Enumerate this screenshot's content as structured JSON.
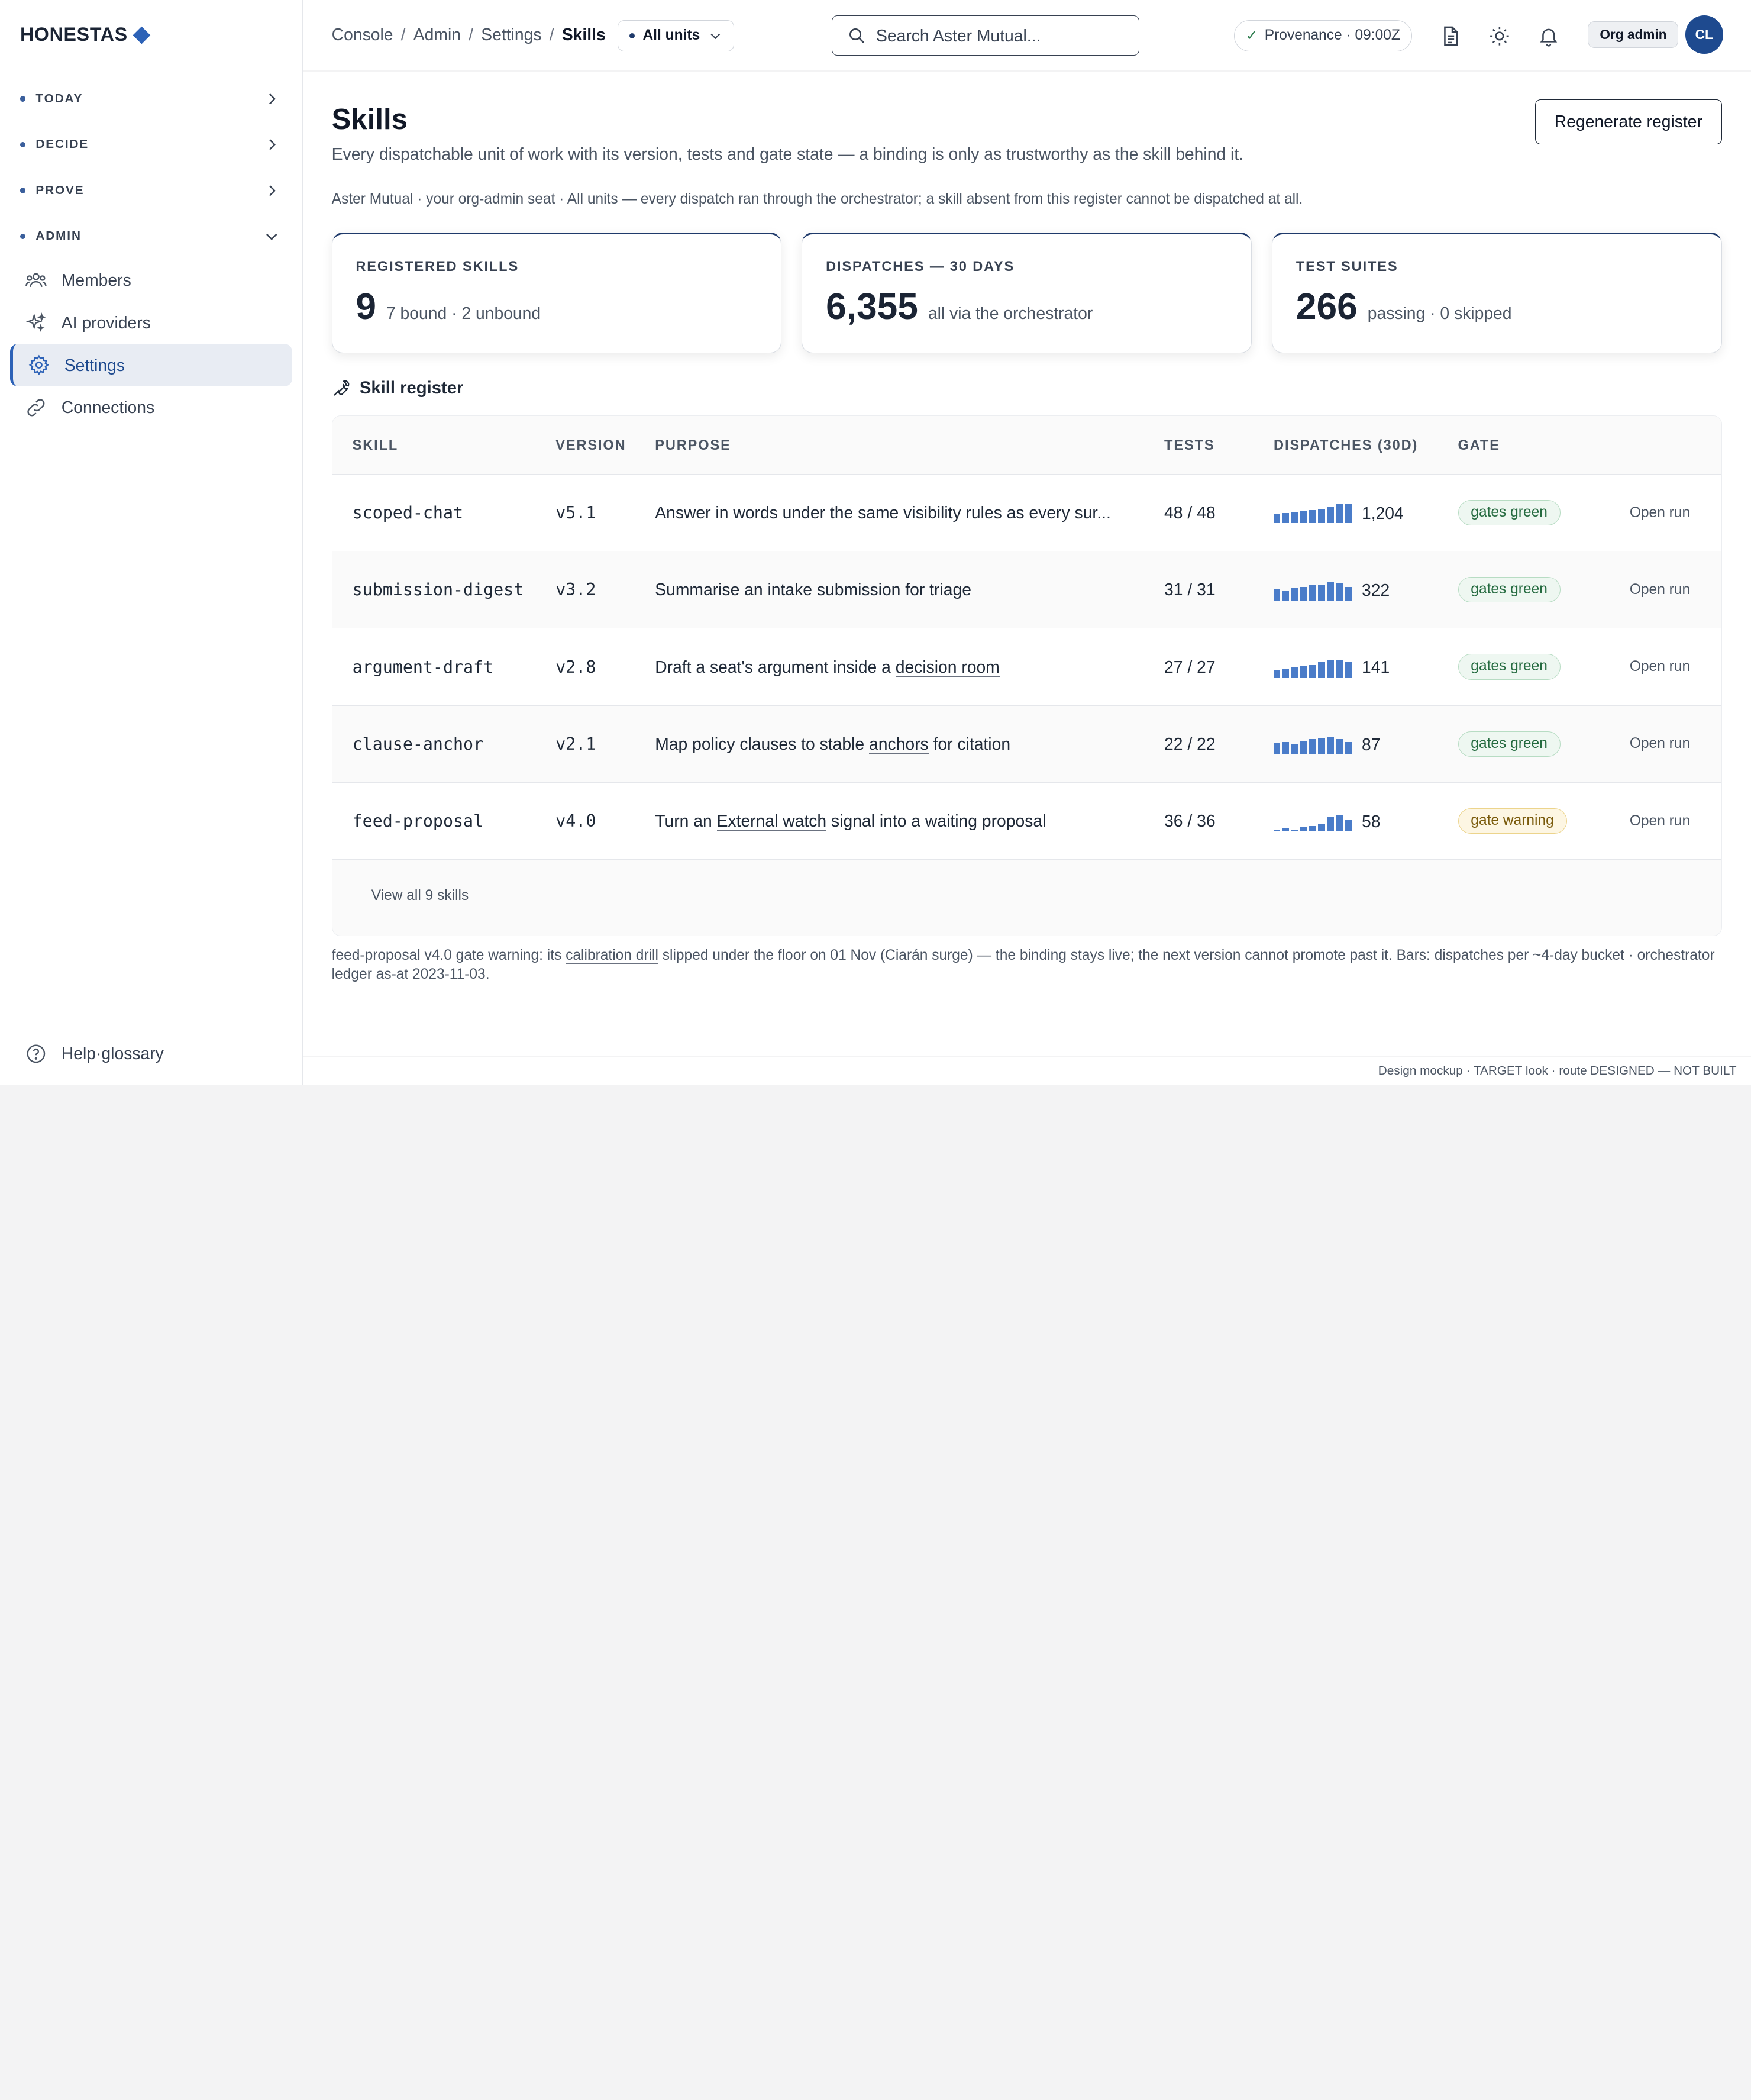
{
  "brand": {
    "name": "HONESTAS"
  },
  "sidebar": {
    "sections": [
      {
        "label": "TODAY"
      },
      {
        "label": "DECIDE"
      },
      {
        "label": "PROVE"
      },
      {
        "label": "ADMIN"
      }
    ],
    "items": [
      {
        "label": "Members",
        "icon": "members-icon"
      },
      {
        "label": "AI providers",
        "icon": "sparkles-icon"
      },
      {
        "label": "Settings",
        "icon": "gear-icon",
        "active": true
      },
      {
        "label": "Connections",
        "icon": "link-icon"
      }
    ],
    "footer": {
      "label": "Help·glossary",
      "icon": "help-icon"
    }
  },
  "topbar": {
    "breadcrumb": [
      "Console",
      "Admin",
      "Settings",
      "Skills"
    ],
    "units_label": "All units",
    "search_placeholder": "Search Aster Mutual...",
    "provenance": "Provenance · 09:00Z",
    "role": "Org admin",
    "avatar": "CL"
  },
  "page": {
    "title": "Skills",
    "subtitle": "Every dispatchable unit of work with its version, tests and gate state — a binding is only as trustworthy as the skill behind it.",
    "regen_label": "Regenerate register",
    "context": "Aster Mutual · your org-admin seat · All units — every dispatch ran through the orchestrator; a skill absent from this register cannot be dispatched at all."
  },
  "stats": [
    {
      "label": "REGISTERED SKILLS",
      "value": "9",
      "note": "7 bound · 2 unbound"
    },
    {
      "label": "DISPATCHES — 30 DAYS",
      "value": "6,355",
      "note": "all via the orchestrator"
    },
    {
      "label": "TEST SUITES",
      "value": "266",
      "note": "passing · 0 skipped"
    }
  ],
  "register": {
    "title": "Skill register",
    "columns": {
      "skill": "SKILL",
      "version": "VERSION",
      "purpose": "PURPOSE",
      "tests": "TESTS",
      "dispatches": "DISPATCHES (30D)",
      "gate": "GATE"
    },
    "rows": [
      {
        "skill": "scoped-chat",
        "version": "v5.1",
        "purpose_parts": [
          {
            "t": "Answer in words under the same visibility rules as every sur..."
          }
        ],
        "tests": "48 / 48",
        "spark": [
          0.45,
          0.5,
          0.55,
          0.6,
          0.65,
          0.7,
          0.85,
          0.95,
          0.95
        ],
        "dispatches": "1,204",
        "gate": "gates green",
        "gate_status": "green",
        "action": "Open run"
      },
      {
        "skill": "submission-digest",
        "version": "v3.2",
        "purpose_parts": [
          {
            "t": "Summarise an intake submission for triage"
          }
        ],
        "tests": "31 / 31",
        "spark": [
          0.55,
          0.5,
          0.6,
          0.65,
          0.75,
          0.8,
          0.9,
          0.85,
          0.65
        ],
        "dispatches": "322",
        "gate": "gates green",
        "gate_status": "green",
        "action": "Open run"
      },
      {
        "skill": "argument-draft",
        "version": "v2.8",
        "purpose_parts": [
          {
            "t": "Draft a seat's argument inside a "
          },
          {
            "t": "decision room",
            "u": true
          }
        ],
        "tests": "27 / 27",
        "spark": [
          0.35,
          0.45,
          0.5,
          0.55,
          0.6,
          0.75,
          0.85,
          0.9,
          0.8
        ],
        "dispatches": "141",
        "gate": "gates green",
        "gate_status": "green",
        "action": "Open run"
      },
      {
        "skill": "clause-anchor",
        "version": "v2.1",
        "purpose_parts": [
          {
            "t": "Map policy clauses to stable "
          },
          {
            "t": "anchors",
            "u": true
          },
          {
            "t": " for citation"
          }
        ],
        "tests": "22 / 22",
        "spark": [
          0.55,
          0.6,
          0.5,
          0.65,
          0.75,
          0.85,
          0.9,
          0.75,
          0.6
        ],
        "dispatches": "87",
        "gate": "gates green",
        "gate_status": "green",
        "action": "Open run"
      },
      {
        "skill": "feed-proposal",
        "version": "v4.0",
        "purpose_parts": [
          {
            "t": "Turn an "
          },
          {
            "t": "External watch",
            "u": true
          },
          {
            "t": " signal into a waiting proposal"
          }
        ],
        "tests": "36 / 36",
        "spark": [
          0.1,
          0.15,
          0.1,
          0.2,
          0.25,
          0.4,
          0.7,
          0.85,
          0.6
        ],
        "dispatches": "58",
        "gate": "gate warning",
        "gate_status": "warn",
        "action": "Open run"
      }
    ],
    "view_all": "View all 9 skills"
  },
  "footnote_parts": [
    {
      "t": "feed-proposal v4.0 gate warning: its "
    },
    {
      "t": "calibration drill",
      "u": true
    },
    {
      "t": " slipped under the floor on 01 Nov (Ciarán surge) — the binding stays live; the next version cannot promote past it. Bars: dispatches per ~4-day bucket · orchestrator ledger as-at 2023-11-03."
    }
  ],
  "status_strip": "Design mockup · TARGET look · route DESIGNED — NOT BUILT",
  "colors": {
    "accent": "#2d62b7",
    "navy": "#1f3a6b",
    "bar": "#4a7cc9",
    "green": "#256b40",
    "warn": "#7a5b0c"
  }
}
